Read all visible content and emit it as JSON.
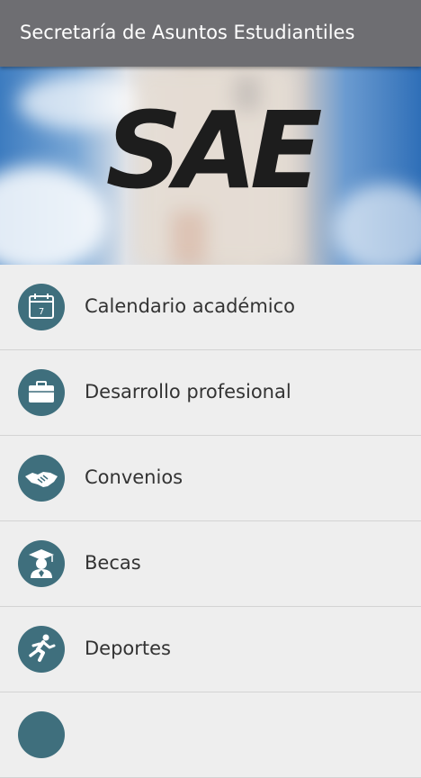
{
  "app_bar": {
    "title": "Secretaría de Asuntos Estudiantiles"
  },
  "banner": {
    "logo_text": "SAE"
  },
  "menu": {
    "items": [
      {
        "label": "Calendario académico",
        "icon": "calendar-icon"
      },
      {
        "label": "Desarrollo profesional",
        "icon": "briefcase-icon"
      },
      {
        "label": "Convenios",
        "icon": "handshake-icon"
      },
      {
        "label": "Becas",
        "icon": "graduate-icon"
      },
      {
        "label": "Deportes",
        "icon": "running-icon"
      },
      {
        "label": "",
        "icon": "more-icon"
      }
    ]
  },
  "colors": {
    "app_bar": "#6e6e72",
    "icon_circle": "#3f6f7d",
    "background": "#eeeeee"
  }
}
